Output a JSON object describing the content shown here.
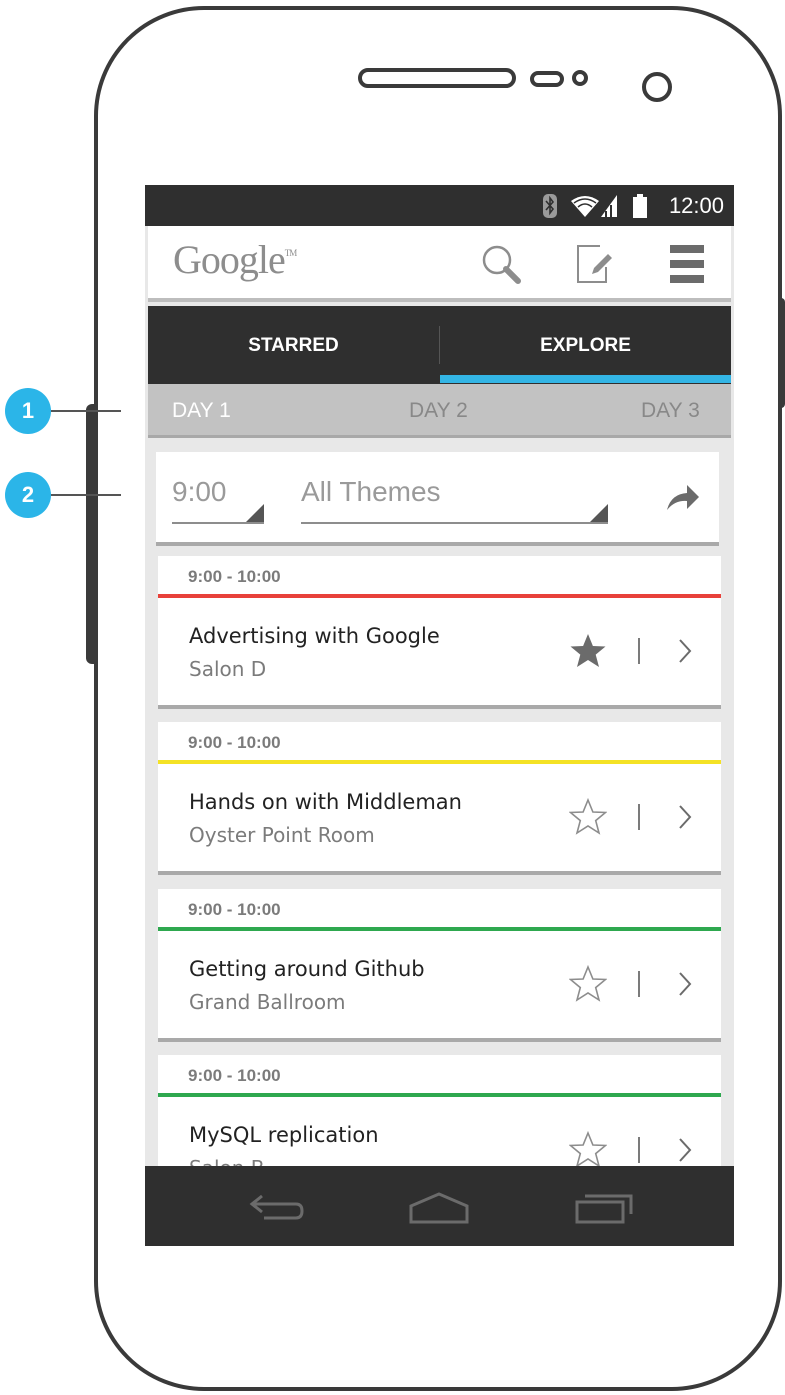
{
  "colors": {
    "accent": "#33b5e5",
    "callout": "#2bb5e8",
    "dark_bar": "#2f2f2f",
    "red": "#e8413a",
    "yellow": "#f4e225",
    "green": "#2ea84f"
  },
  "status_bar": {
    "time": "12:00",
    "icons": [
      "bluetooth-icon",
      "wifi-icon",
      "signal-icon",
      "battery-icon"
    ]
  },
  "action_bar": {
    "logo": "Google",
    "logo_mark": "TM",
    "icons": [
      "search-icon",
      "compose-icon",
      "menu-icon"
    ]
  },
  "tabs": [
    {
      "label": "STARRED",
      "selected": false
    },
    {
      "label": "EXPLORE",
      "selected": true
    }
  ],
  "days": [
    {
      "label": "DAY 1",
      "selected": true
    },
    {
      "label": "DAY 2",
      "selected": false
    },
    {
      "label": "DAY 3",
      "selected": false
    }
  ],
  "filters": {
    "time": "9:00",
    "theme": "All Themes",
    "share_icon": "share-icon"
  },
  "sessions": [
    {
      "time": "9:00 - 10:00",
      "title": "Advertising with Google",
      "room": "Salon D",
      "color": "#e8413a",
      "starred": true
    },
    {
      "time": "9:00 - 10:00",
      "title": "Hands on with Middleman",
      "room": "Oyster Point Room",
      "color": "#f4e225",
      "starred": false
    },
    {
      "time": "9:00 - 10:00",
      "title": "Getting around Github",
      "room": "Grand Ballroom",
      "color": "#2ea84f",
      "starred": false
    },
    {
      "time": "9:00 - 10:00",
      "title": "MySQL replication",
      "room": "Salon B",
      "color": "#2ea84f",
      "starred": false
    }
  ],
  "callouts": [
    "1",
    "2"
  ],
  "nav_bar": {
    "icons": [
      "back-icon",
      "home-icon",
      "recent-apps-icon"
    ]
  }
}
